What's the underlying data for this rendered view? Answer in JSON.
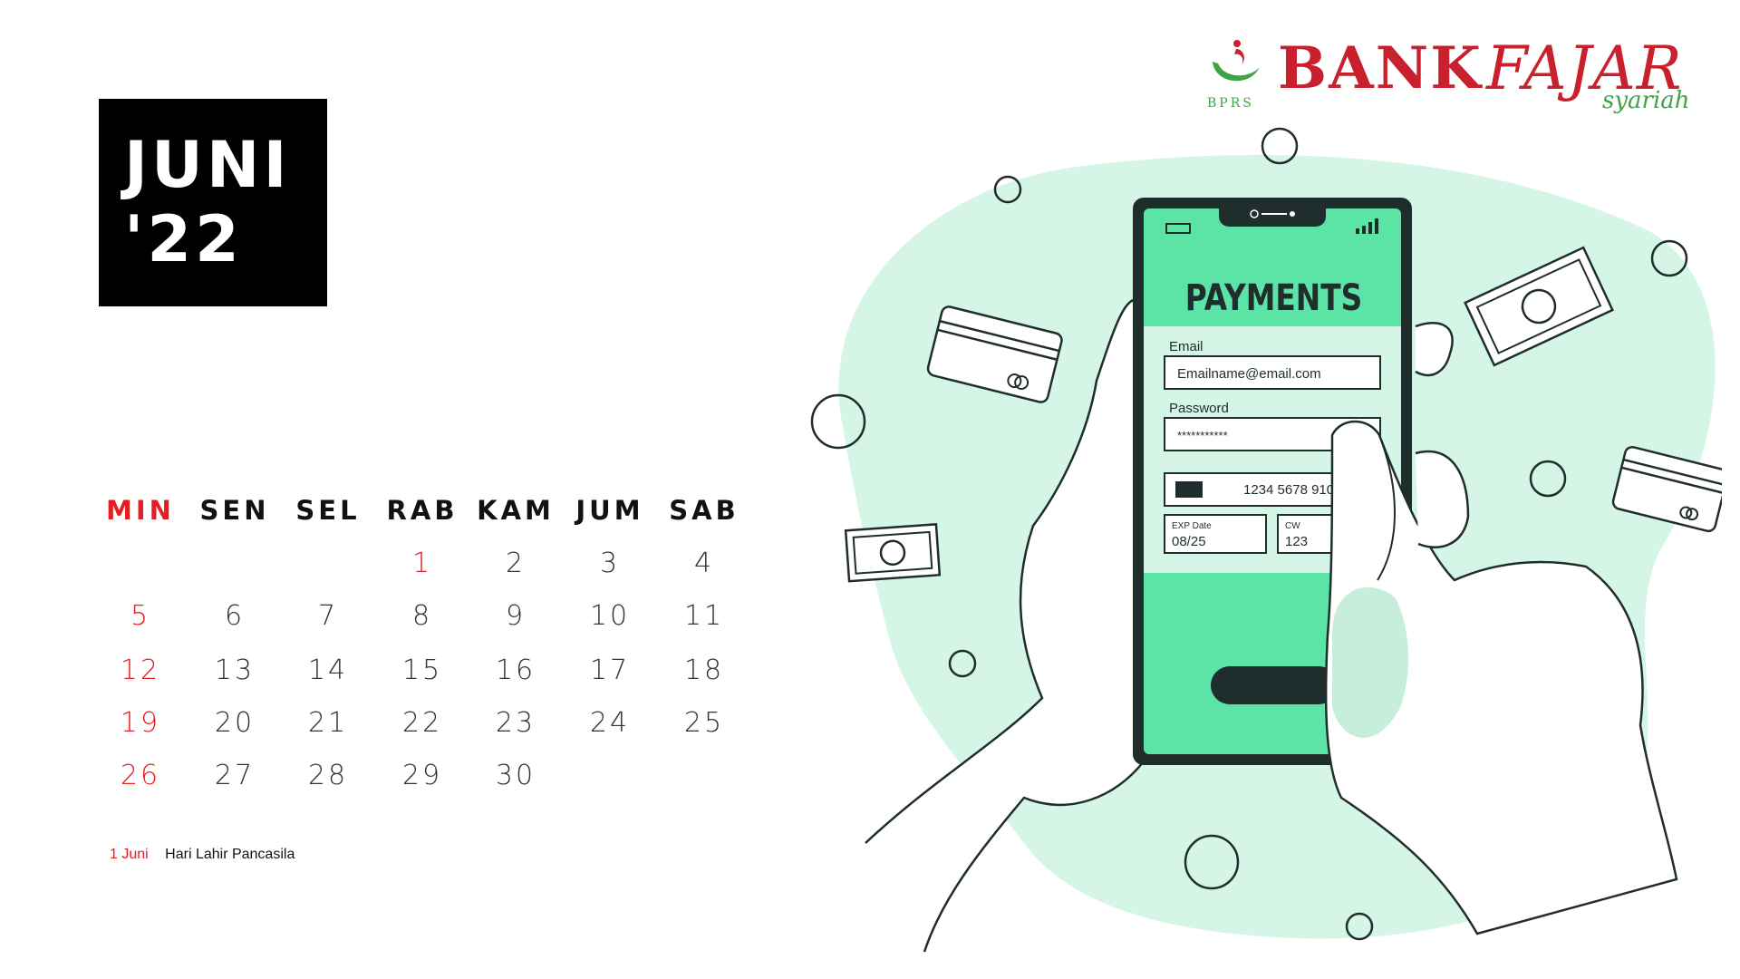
{
  "month": {
    "name": "JUNI",
    "year": "'22"
  },
  "weekdays": [
    "MIN",
    "SEN",
    "SEL",
    "RAB",
    "KAM",
    "JUM",
    "SAB"
  ],
  "weeks": [
    [
      "",
      "",
      "",
      "1",
      "2",
      "3",
      "4"
    ],
    [
      "5",
      "6",
      "7",
      "8",
      "9",
      "10",
      "11"
    ],
    [
      "12",
      "13",
      "14",
      "15",
      "16",
      "17",
      "18"
    ],
    [
      "19",
      "20",
      "21",
      "22",
      "23",
      "24",
      "25"
    ],
    [
      "26",
      "27",
      "28",
      "29",
      "30",
      "",
      ""
    ]
  ],
  "holidays": [
    {
      "date": "1 Juni",
      "name": "Hari Lahir Pancasila"
    }
  ],
  "logo": {
    "bank": "BANK",
    "fajar": "FAJAR",
    "syariah": "syariah",
    "bprs": "BPRS"
  },
  "phone": {
    "title": "PAYMENTS",
    "email_label": "Email",
    "email_value": "Emailname@email.com",
    "password_label": "Password",
    "password_value": "***********",
    "card_number": "1234 5678 910",
    "exp_label": "EXP Date",
    "exp_value": "08/25",
    "cvv_label": "CW",
    "cvv_value": "123"
  },
  "colors": {
    "accent_red": "#e31e24",
    "brand_red": "#c8202c",
    "brand_green": "#3ea447",
    "mint_light": "#d5f6e6",
    "mint": "#5ce3a6",
    "outline": "#1f2d2d"
  }
}
